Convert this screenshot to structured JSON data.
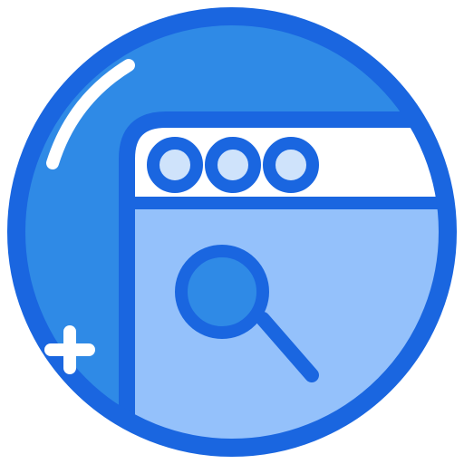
{
  "icon": {
    "name": "browser-search-icon",
    "colors": {
      "outline": "#1a66e0",
      "circle_fill": "#2f8ae6",
      "window_fill": "#94c1fb",
      "titlebar_fill": "#ffffff",
      "dot_fill": "#cfe3fb",
      "lens_fill": "#2f8ae6",
      "highlight": "#ffffff"
    },
    "parts": [
      "circle-badge",
      "browser-window",
      "title-bar",
      "window-control-dots",
      "magnifier",
      "sparkle-plus",
      "gloss-highlight"
    ]
  }
}
